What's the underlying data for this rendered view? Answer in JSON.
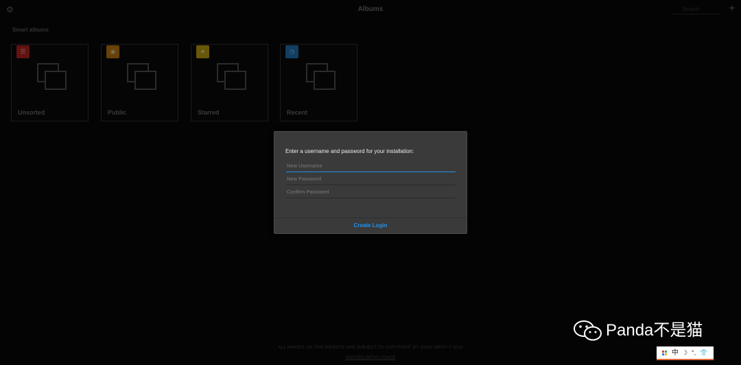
{
  "header": {
    "title": "Albums",
    "search_placeholder": "Search",
    "settings_icon": "gear-icon",
    "add_icon": "plus-icon"
  },
  "smart_albums": {
    "section_title": "Smart albums",
    "items": [
      {
        "label": "Unsorted",
        "icon": "list-icon",
        "badge_color": "#b01c1c"
      },
      {
        "label": "Public",
        "icon": "eye-icon",
        "badge_color": "#b8730c"
      },
      {
        "label": "Starred",
        "icon": "star-icon",
        "badge_color": "#b89b0c"
      },
      {
        "label": "Recent",
        "icon": "clock-icon",
        "badge_color": "#1c6db0"
      }
    ]
  },
  "login_dialog": {
    "prompt": "Enter a username and password for your installation:",
    "username_placeholder": "New Username",
    "password_placeholder": "New Password",
    "confirm_placeholder": "Confirm Password",
    "submit_label": "Create Login",
    "accent_color": "#2293ec"
  },
  "footer": {
    "copyright": "ALL IMAGES ON THIS WEBSITE ARE SUBJECT TO COPYRIGHT BY JOHN SMITH © 2018",
    "hosted": "HOSTED WITH LYCHEE"
  },
  "watermark": {
    "text": "Panda不是猫"
  },
  "ime_toolbar": {
    "mode": "中",
    "moon": "☽",
    "punct": "°,",
    "skin": "👕"
  }
}
